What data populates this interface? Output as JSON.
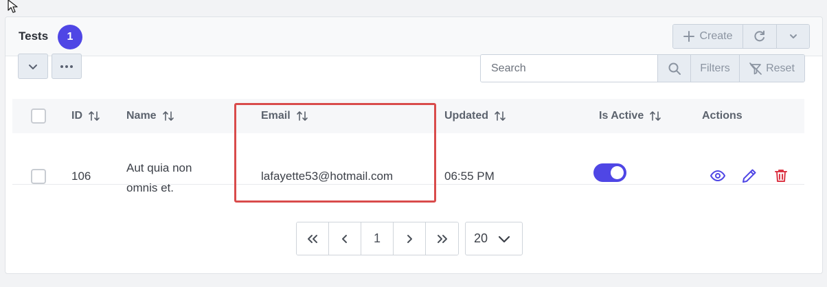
{
  "header": {
    "title": "Tests",
    "count": "1",
    "create_label": "Create"
  },
  "toolbar": {
    "search_placeholder": "Search",
    "filters_label": "Filters",
    "reset_label": "Reset"
  },
  "table": {
    "columns": {
      "id": "ID",
      "name": "Name",
      "email": "Email",
      "updated": "Updated",
      "is_active": "Is Active",
      "actions": "Actions"
    },
    "rows": [
      {
        "id": "106",
        "name_line1": "Aut quia non",
        "name_line2": "omnis et.",
        "email": "lafayette53@hotmail.com",
        "updated": "06:55 PM",
        "is_active": true
      }
    ]
  },
  "pagination": {
    "current_page": "1",
    "per_page": "20"
  },
  "colors": {
    "accent": "#4f46e5",
    "delete": "#dc3545",
    "highlight": "#d94b4b"
  },
  "icons": [
    "cursor-icon",
    "plus-icon",
    "refresh-icon",
    "chevron-down-icon",
    "more-icon",
    "search-icon",
    "filter-off-icon",
    "sort-icon",
    "eye-icon",
    "pencil-icon",
    "trash-icon",
    "first-page-icon",
    "prev-page-icon",
    "next-page-icon",
    "last-page-icon"
  ]
}
